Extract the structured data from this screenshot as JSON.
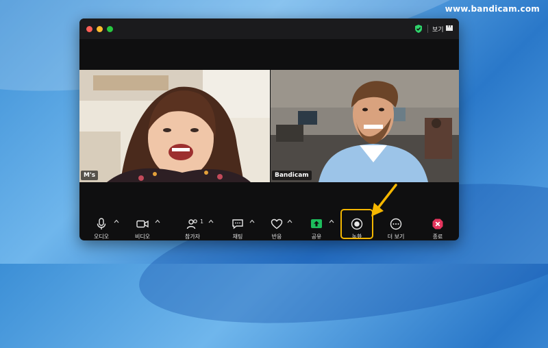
{
  "watermark": "www.bandicam.com",
  "titlebar": {
    "view_label": "보기",
    "shield_color": "#2fd36b"
  },
  "participants": [
    {
      "name": "M's"
    },
    {
      "name": "Bandicam"
    }
  ],
  "toolbar": {
    "audio": "오디오",
    "video": "비디오",
    "participants": "참가자",
    "participants_count": "1",
    "chat": "채팅",
    "reactions": "반응",
    "share": "공유",
    "record": "녹화",
    "more": "더 보기",
    "end": "종료"
  },
  "colors": {
    "highlight": "#f5b700",
    "share_green": "#1dbc5c",
    "end_red": "#e5345d"
  }
}
